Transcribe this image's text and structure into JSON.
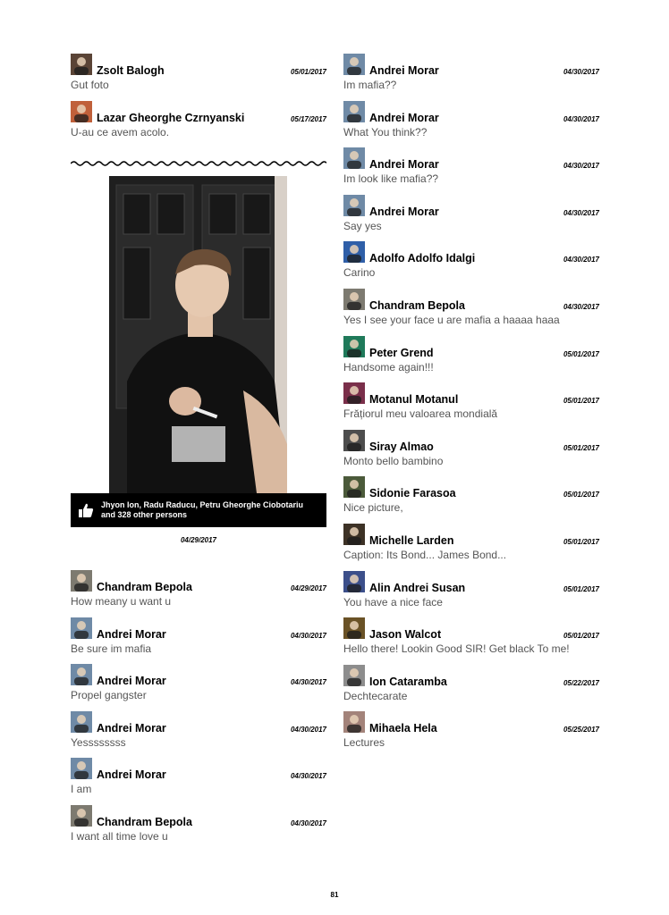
{
  "left_top_comments": [
    {
      "name": "Zsolt Balogh",
      "date": "05/01/2017",
      "text": "Gut foto",
      "avatar": "#5a4436"
    },
    {
      "name": "Lazar Gheorghe Czrnyanski",
      "date": "05/17/2017",
      "text": "U-au ce avem acolo.",
      "avatar": "#c0603a"
    }
  ],
  "post": {
    "likes": "Jhyon Ion, Radu Raducu, Petru Gheorghe Ciobotariu and 328 other persons",
    "date": "04/29/2017"
  },
  "left_bottom_comments": [
    {
      "name": "Chandram Bepola",
      "date": "04/29/2017",
      "text": "How meany u want u",
      "avatar": "#7d7a70"
    },
    {
      "name": "Andrei Morar",
      "date": "04/30/2017",
      "text": "Be sure im mafia",
      "avatar": "#6f8aa6"
    },
    {
      "name": "Andrei Morar",
      "date": "04/30/2017",
      "text": "Propel gangster",
      "avatar": "#6f8aa6"
    },
    {
      "name": "Andrei Morar",
      "date": "04/30/2017",
      "text": "Yessssssss",
      "avatar": "#6f8aa6"
    },
    {
      "name": "Andrei Morar",
      "date": "04/30/2017",
      "text": "I am",
      "avatar": "#6f8aa6"
    },
    {
      "name": "Chandram Bepola",
      "date": "04/30/2017",
      "text": "I want all time love u",
      "avatar": "#7d7a70"
    }
  ],
  "right_comments": [
    {
      "name": "Andrei Morar",
      "date": "04/30/2017",
      "text": "Im mafia??",
      "avatar": "#6f8aa6"
    },
    {
      "name": "Andrei Morar",
      "date": "04/30/2017",
      "text": "What You think??",
      "avatar": "#6f8aa6"
    },
    {
      "name": "Andrei Morar",
      "date": "04/30/2017",
      "text": "Im look like mafia??",
      "avatar": "#6f8aa6"
    },
    {
      "name": "Andrei Morar",
      "date": "04/30/2017",
      "text": "Say yes",
      "avatar": "#6f8aa6"
    },
    {
      "name": "Adolfo Adolfo Idalgi",
      "date": "04/30/2017",
      "text": "Carino",
      "avatar": "#2f5fa8"
    },
    {
      "name": "Chandram Bepola",
      "date": "04/30/2017",
      "text": "Yes I see your face u are mafia a haaaa haaa",
      "avatar": "#7d7a70"
    },
    {
      "name": "Peter Grend",
      "date": "05/01/2017",
      "text": "Handsome again!!!",
      "avatar": "#1f7a5a"
    },
    {
      "name": "Motanul Motanul",
      "date": "05/01/2017",
      "text": "Frățiorul meu valoarea mondială",
      "avatar": "#7a2f4a"
    },
    {
      "name": "Siray Almao",
      "date": "05/01/2017",
      "text": "Monto bello bambino",
      "avatar": "#4d4d4d"
    },
    {
      "name": "Sidonie Farasoa",
      "date": "05/01/2017",
      "text": "Nice picture,",
      "avatar": "#4b5a3a"
    },
    {
      "name": "Michelle Larden",
      "date": "05/01/2017",
      "text": "Caption: Its Bond... James Bond...",
      "avatar": "#3d3226"
    },
    {
      "name": "Alin Andrei Susan",
      "date": "05/01/2017",
      "text": "You have a nice face",
      "avatar": "#3c4f8a"
    },
    {
      "name": "Jason Walcot",
      "date": "05/01/2017",
      "text": "Hello there! Lookin Good SIR! Get black To me!",
      "avatar": "#6a5226"
    },
    {
      "name": "Ion Cataramba",
      "date": "05/22/2017",
      "text": "Dechtecarate",
      "avatar": "#8d8d8d"
    },
    {
      "name": "Mihaela Hela",
      "date": "05/25/2017",
      "text": "Lectures",
      "avatar": "#a3837a"
    }
  ],
  "page_number": "81"
}
